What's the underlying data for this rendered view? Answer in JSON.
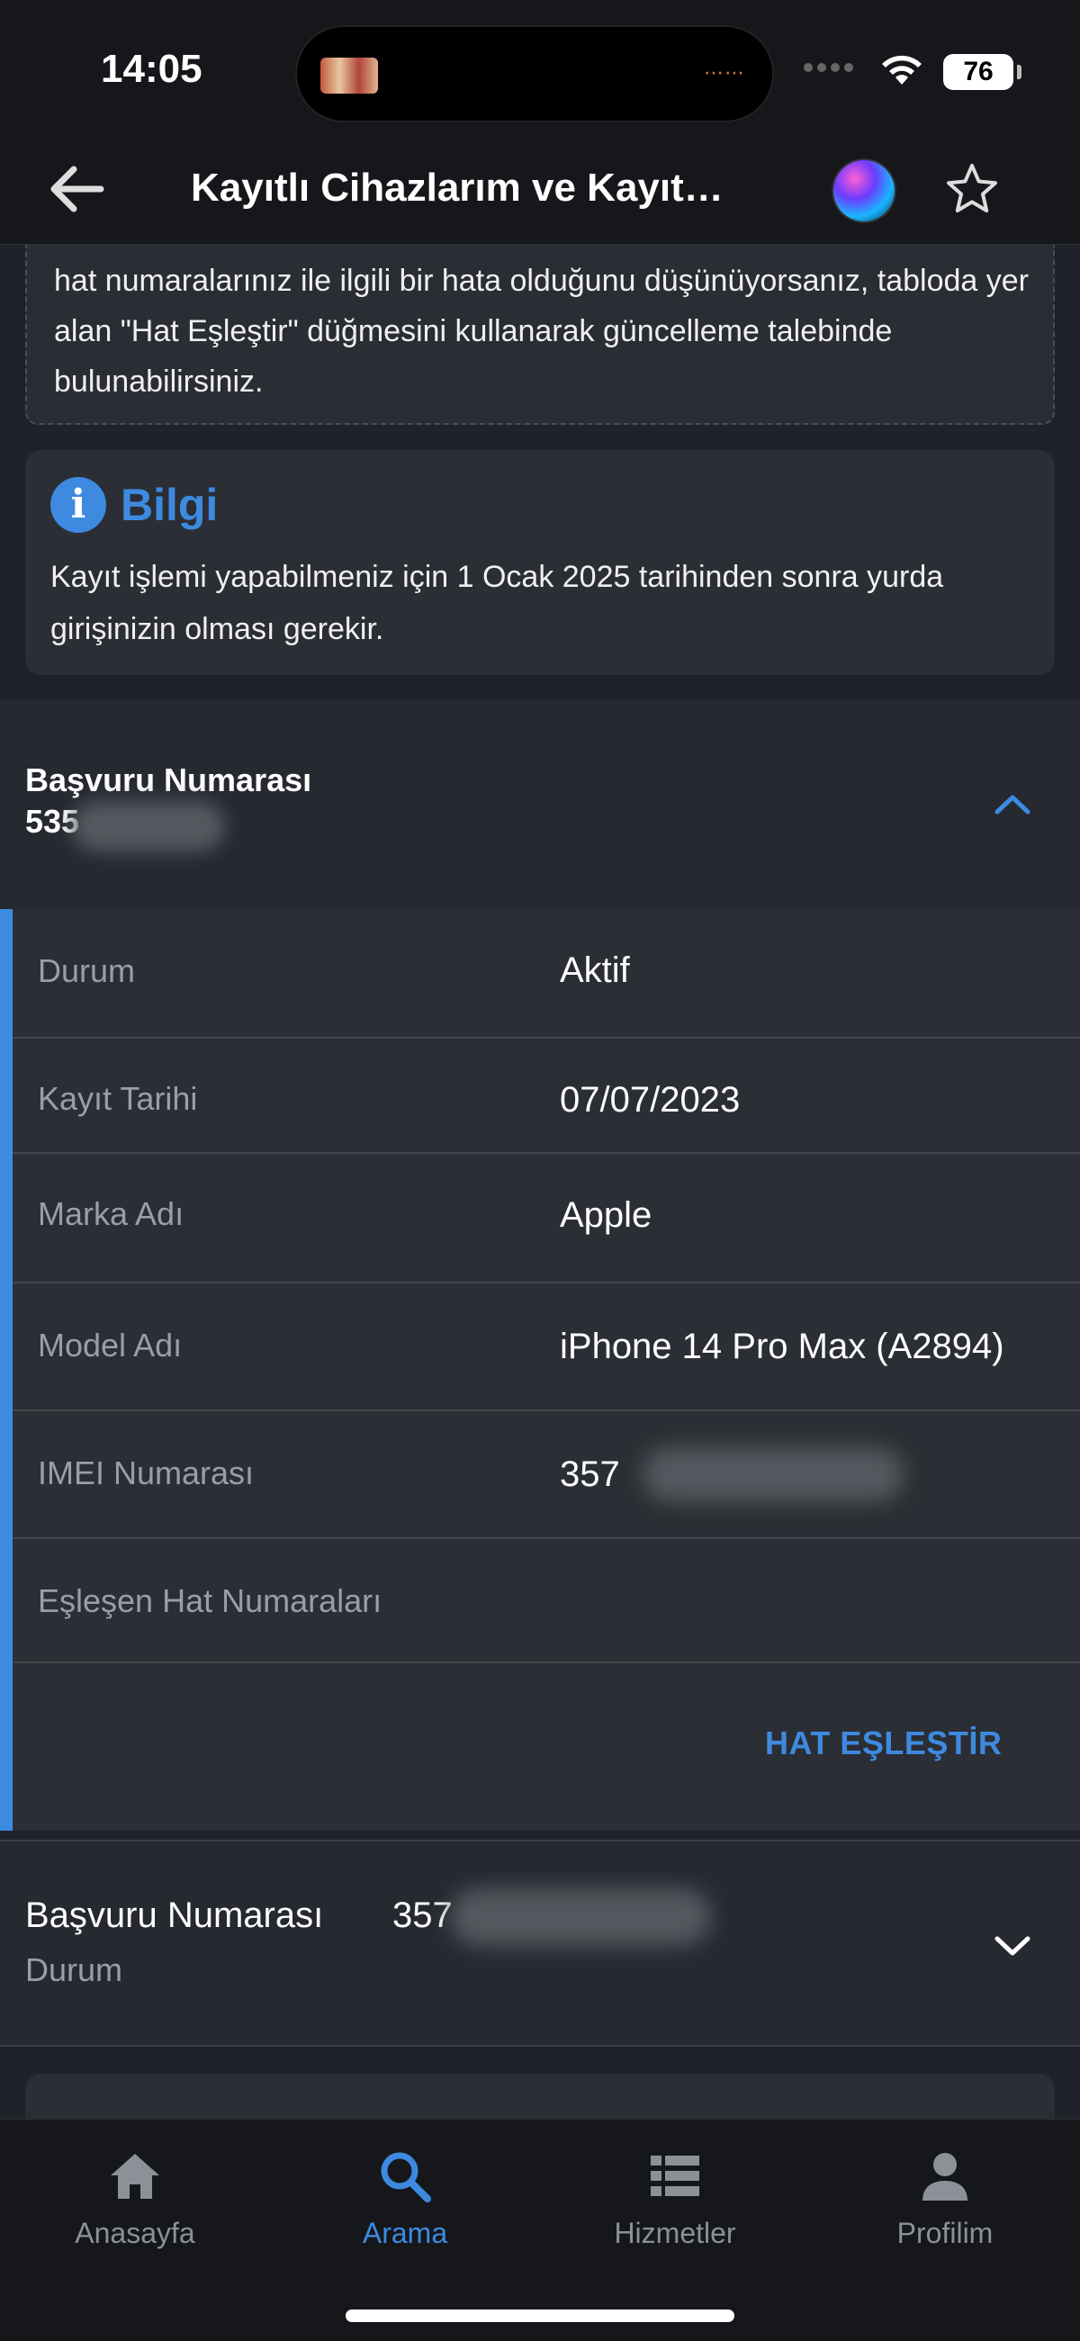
{
  "status_bar": {
    "time": "14:05",
    "battery": "76"
  },
  "header": {
    "title": "Kayıtlı Cihazlarım ve Kayıt…"
  },
  "notice": {
    "text": "hat numaralarınız ile ilgili bir hata olduğunu düşünüyorsanız, tabloda yer alan \"Hat Eşleştir\" düğmesini kullanarak güncelleme talebinde bulunabilirsiniz."
  },
  "info": {
    "title": "Bilgi",
    "text": "Kayıt işlemi yapabilmeniz için 1 Ocak 2025 tarihinden sonra yurda girişinizin olması gerekir."
  },
  "application_1": {
    "label": "Başvuru Numarası",
    "number_visible": "535",
    "expanded": true,
    "rows": [
      {
        "label": "Durum",
        "value": "Aktif"
      },
      {
        "label": "Kayıt Tarihi",
        "value": "07/07/2023"
      },
      {
        "label": "Marka Adı",
        "value": "Apple"
      },
      {
        "label": "Model Adı",
        "value": "iPhone 14 Pro Max (A2894)"
      },
      {
        "label": "IMEI Numarası",
        "value": "357"
      },
      {
        "label": "Eşleşen Hat Numaraları",
        "value": ""
      }
    ],
    "action_label": "HAT EŞLEŞTİR"
  },
  "application_2": {
    "label": "Başvuru Numarası",
    "number_visible": "357",
    "status_label": "Durum",
    "expanded": false
  },
  "tabs": [
    {
      "label": "Anasayfa",
      "icon": "home-icon",
      "active": false
    },
    {
      "label": "Arama",
      "icon": "search-icon",
      "active": true
    },
    {
      "label": "Hizmetler",
      "icon": "list-icon",
      "active": false
    },
    {
      "label": "Profilim",
      "icon": "profile-icon",
      "active": false
    }
  ],
  "colors": {
    "accent": "#3d8ae0",
    "background": "#1f2228",
    "card": "#2b2e34"
  }
}
